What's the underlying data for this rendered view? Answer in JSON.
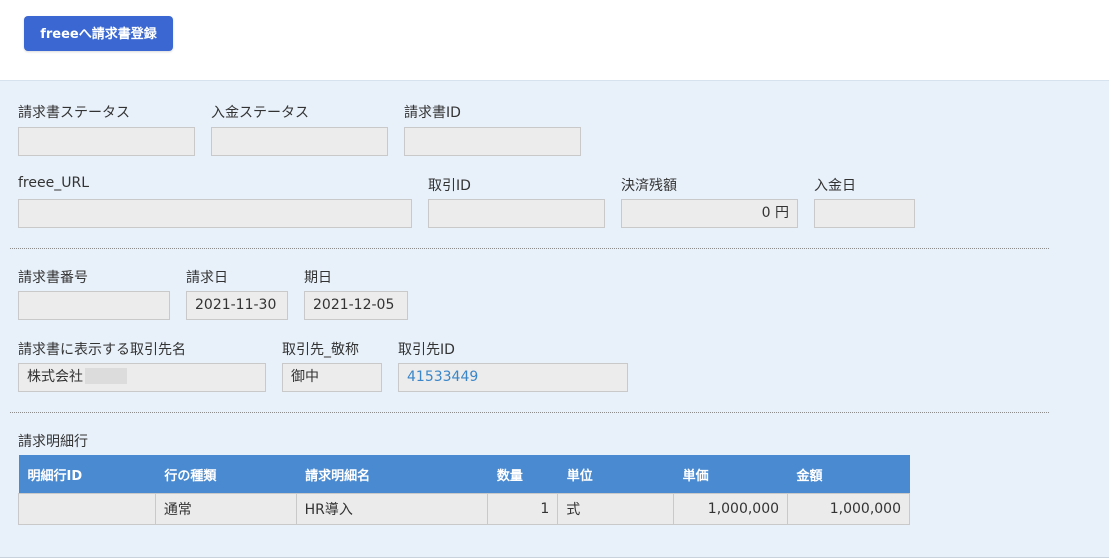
{
  "header": {
    "register_button": "freeeへ請求書登録"
  },
  "invoice_status": {
    "label": "請求書ステータス",
    "value": ""
  },
  "payment_status": {
    "label": "入金ステータス",
    "value": ""
  },
  "invoice_id": {
    "label": "請求書ID",
    "value": ""
  },
  "freee_url": {
    "label": "freee_URL",
    "value": ""
  },
  "deal_id": {
    "label": "取引ID",
    "value": ""
  },
  "settlement_balance": {
    "label": "決済残額",
    "value": "0 円"
  },
  "payment_date": {
    "label": "入金日",
    "value": ""
  },
  "invoice_number": {
    "label": "請求書番号",
    "value": ""
  },
  "billing_date": {
    "label": "請求日",
    "value": "2021-11-30"
  },
  "due_date": {
    "label": "期日",
    "value": "2021-12-05"
  },
  "partner_display_name": {
    "label": "請求書に表示する取引先名",
    "value": "株式会社"
  },
  "partner_title": {
    "label": "取引先_敬称",
    "value": "御中"
  },
  "partner_id": {
    "label": "取引先ID",
    "value": "41533449"
  },
  "invoice_lines": {
    "title": "請求明細行",
    "columns": [
      "明細行ID",
      "行の種類",
      "請求明細名",
      "数量",
      "単位",
      "単価",
      "金額"
    ],
    "rows": [
      [
        "",
        "通常",
        "HR導入",
        "1",
        "式",
        "1,000,000",
        "1,000,000"
      ]
    ]
  },
  "colors": {
    "primary_button": "#3a67d1",
    "panel_background": "#e8f1fa",
    "table_header": "#4a8ad0",
    "link_text": "#3a86c9"
  }
}
